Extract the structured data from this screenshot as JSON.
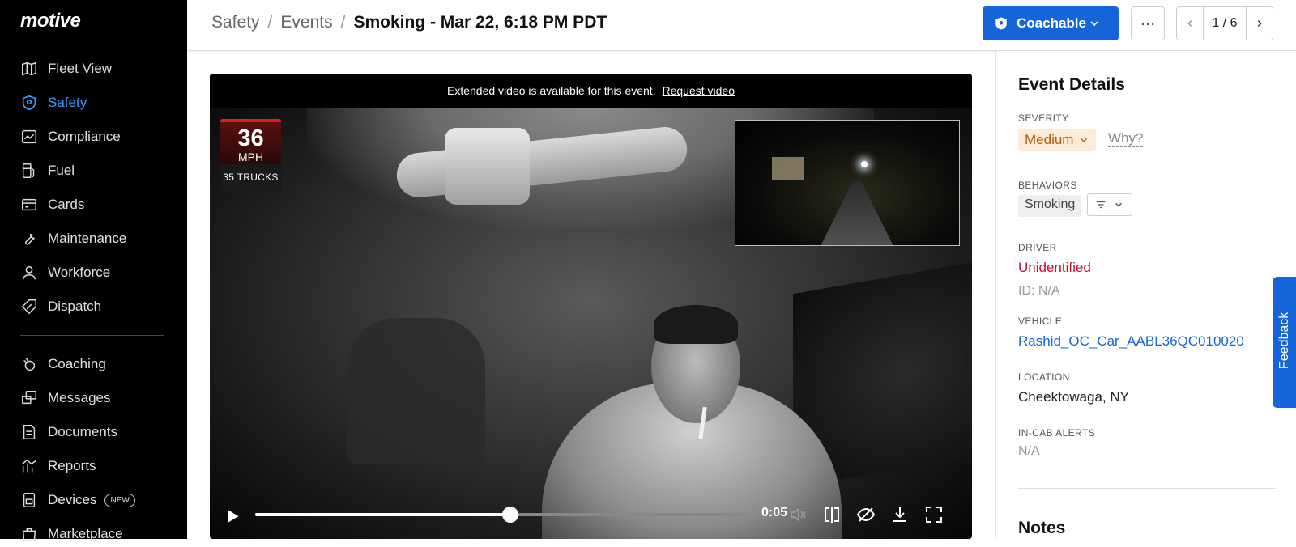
{
  "sidebar": {
    "logo": "motive",
    "items": [
      {
        "label": "Fleet View",
        "icon": "map-icon"
      },
      {
        "label": "Safety",
        "icon": "shield-icon"
      },
      {
        "label": "Compliance",
        "icon": "chart-card-icon"
      },
      {
        "label": "Fuel",
        "icon": "fuel-pump-icon"
      },
      {
        "label": "Cards",
        "icon": "credit-card-icon"
      },
      {
        "label": "Maintenance",
        "icon": "wrench-icon"
      },
      {
        "label": "Workforce",
        "icon": "person-icon"
      },
      {
        "label": "Dispatch",
        "icon": "tag-icon"
      },
      {
        "label": "Coaching",
        "icon": "whistle-icon"
      },
      {
        "label": "Messages",
        "icon": "messages-icon"
      },
      {
        "label": "Documents",
        "icon": "document-icon"
      },
      {
        "label": "Reports",
        "icon": "reports-icon"
      },
      {
        "label": "Devices",
        "icon": "devices-icon",
        "badge": "NEW"
      },
      {
        "label": "Marketplace",
        "icon": "marketplace-icon"
      }
    ]
  },
  "header": {
    "breadcrumb": [
      "Safety",
      "Events"
    ],
    "title": "Smoking - Mar 22, 6:18 PM PDT",
    "coach_label": "Coachable",
    "more_label": "···",
    "pager": "1 / 6"
  },
  "video": {
    "banner_text": "Extended video is available for this event.",
    "banner_link": "Request video",
    "speed_value": "36",
    "speed_unit": "MPH",
    "fleet_label": "35 TRUCKS",
    "time": "0:05",
    "progress": 0.52
  },
  "details": {
    "title": "Event Details",
    "severity_label": "SEVERITY",
    "severity_value": "Medium",
    "why_label": "Why?",
    "behaviors_label": "BEHAVIORS",
    "behavior": "Smoking",
    "driver_label": "DRIVER",
    "driver_value": "Unidentified",
    "driver_id": "ID: N/A",
    "vehicle_label": "VEHICLE",
    "vehicle_value": "Rashid_OC_Car_AABL36QC010020",
    "location_label": "LOCATION",
    "location_value": "Cheektowaga, NY",
    "alerts_label": "IN-CAB ALERTS",
    "alerts_value": "N/A",
    "notes_title": "Notes"
  },
  "feedback_label": "Feedback",
  "colors": {
    "accent": "#1565d8",
    "active_nav": "#3b9bff",
    "severity_bg": "#fdebd7",
    "driver_red": "#c8102e"
  }
}
